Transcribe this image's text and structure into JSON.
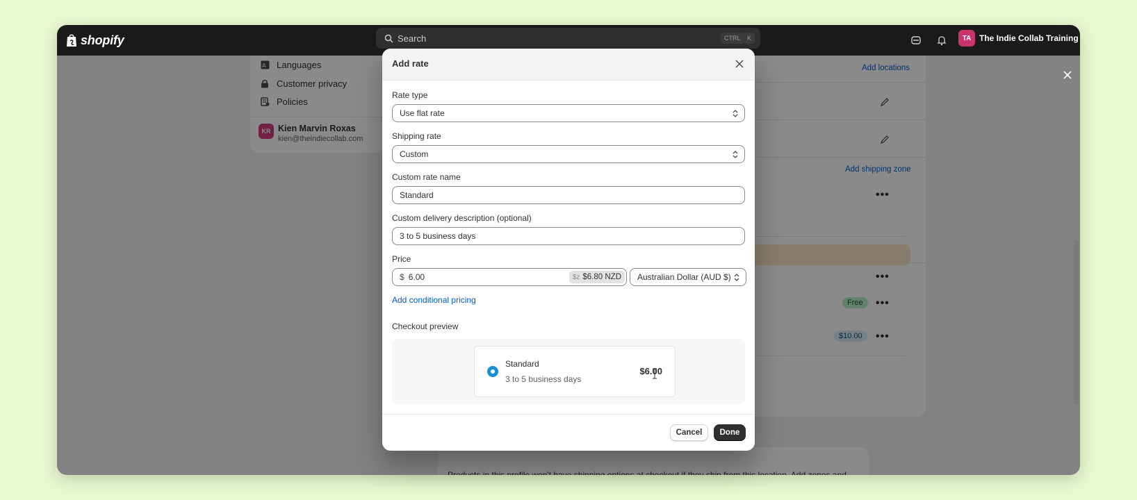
{
  "topbar": {
    "brand": "shopify",
    "search_placeholder": "Search",
    "kbd_1": "CTRL",
    "kbd_2": "K",
    "store_initials": "TA",
    "store_name": "The Indie Collab Training ..."
  },
  "settings_nav": {
    "items": [
      {
        "label": "Languages",
        "icon": "translate-icon"
      },
      {
        "label": "Customer privacy",
        "icon": "lock-icon"
      },
      {
        "label": "Policies",
        "icon": "policy-icon"
      }
    ],
    "user": {
      "initials": "KR",
      "name": "Kien Marvin Roxas",
      "email": "kien@theindiecollab.com"
    }
  },
  "background": {
    "add_locations": "Add locations",
    "add_shipping_zone": "Add shipping zone",
    "badge_free": "Free",
    "badge_price": "$10.00",
    "info_text": "Products in this profile won't have shipping options at checkout if they ship from this location. Add zones and rates to ship from this location."
  },
  "modal": {
    "title": "Add rate",
    "rate_type_label": "Rate type",
    "rate_type_value": "Use flat rate",
    "shipping_rate_label": "Shipping rate",
    "shipping_rate_value": "Custom",
    "custom_name_label": "Custom rate name",
    "custom_name_value": "Standard",
    "description_label": "Custom delivery description (optional)",
    "description_value": "3 to 5 business days",
    "price_label": "Price",
    "price_symbol": "$",
    "price_value": "6.00",
    "converted_currency_symbol": "$z",
    "converted_price": "$6.80 NZD",
    "currency_value": "Australian Dollar (AUD $)",
    "conditional_link": "Add conditional pricing",
    "preview_label": "Checkout preview",
    "preview": {
      "name": "Standard",
      "description": "3 to 5 business days",
      "price": "$6.00"
    },
    "cancel_label": "Cancel",
    "done_label": "Done"
  },
  "colors": {
    "accent_link": "#005bd3",
    "primary_button": "#303030",
    "radio": "#1b8fd4"
  }
}
